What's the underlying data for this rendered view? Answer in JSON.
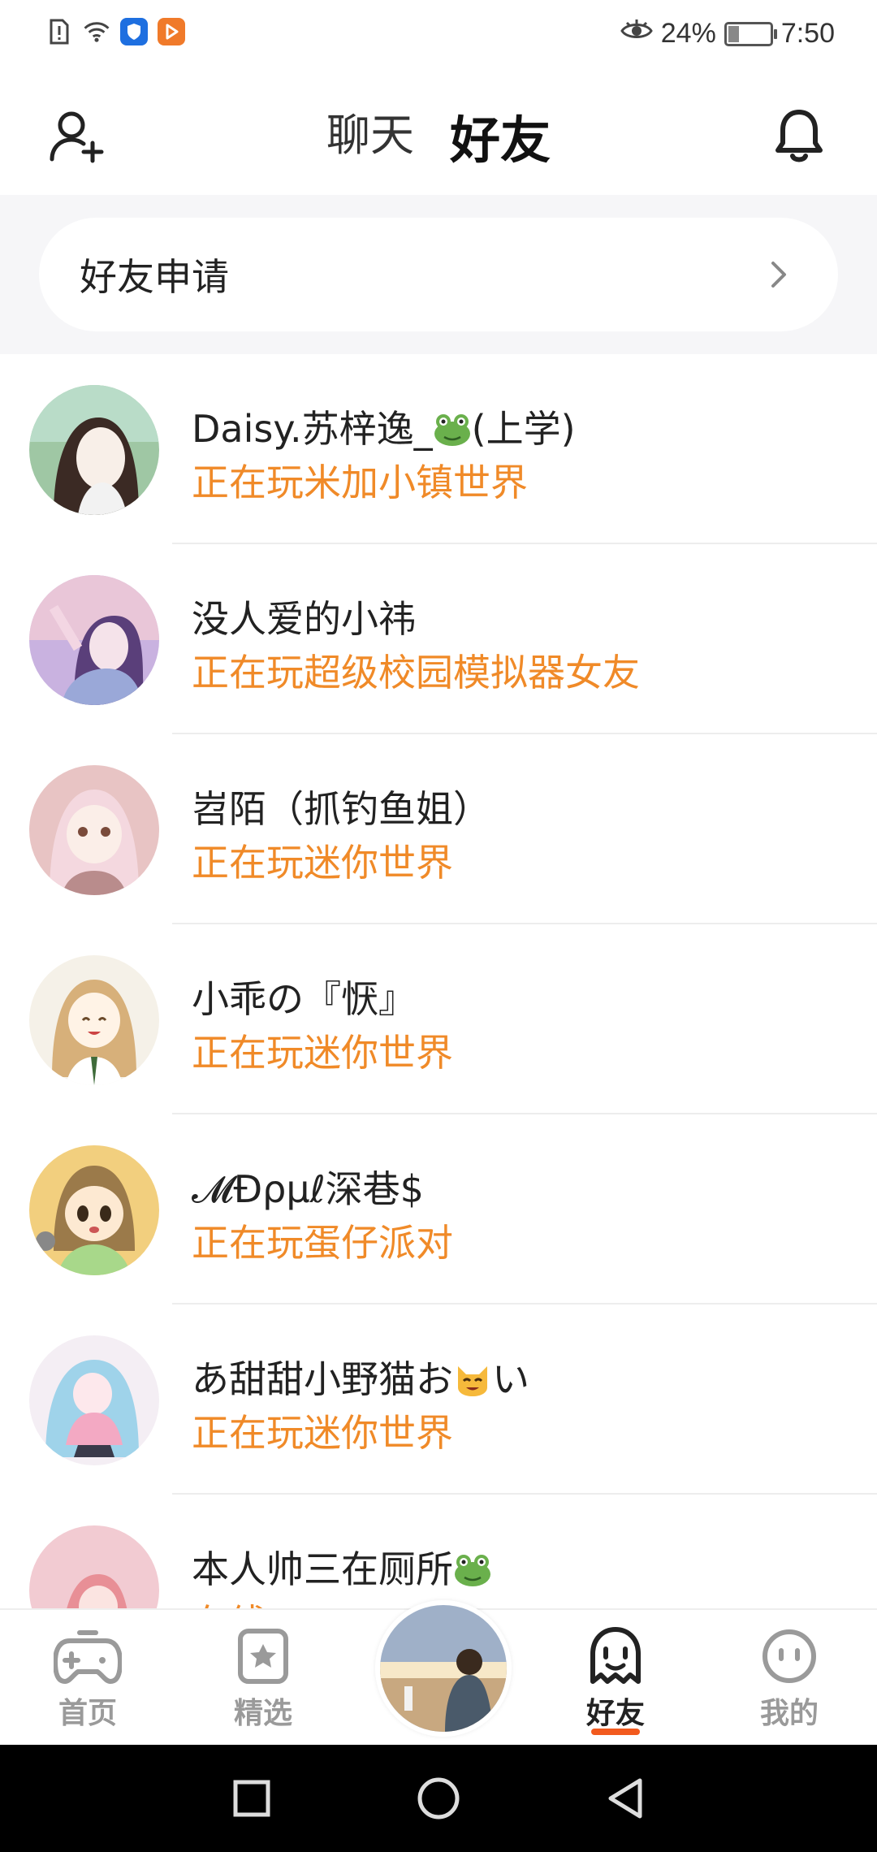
{
  "status_bar": {
    "battery": "24%",
    "time": "7:50",
    "battery_level": 0.24
  },
  "header": {
    "tabs": [
      {
        "label": "聊天"
      },
      {
        "label": "好友"
      }
    ],
    "active_tab": "好友"
  },
  "friend_request": {
    "label": "好友申请"
  },
  "friends": [
    {
      "name": "Daisy.苏梓逸_",
      "name_suffix": "(上学)",
      "status": "正在玩米加小镇世界"
    },
    {
      "name": "没人爱的小祎",
      "status": "正在玩超级校园模拟器女友"
    },
    {
      "name": "岧陌（抓钓鱼姐）",
      "status": "正在玩迷你世界"
    },
    {
      "name": "小乖の『恹』",
      "status": "正在玩迷你世界"
    },
    {
      "name": "𝓜Ɖρμℓ深巷$",
      "status": "正在玩蛋仔派对"
    },
    {
      "name": "あ甜甜小野猫お",
      "name_suffix": "い",
      "status": "正在玩迷你世界"
    },
    {
      "name": "本人帅三在厕所",
      "status": "在线"
    }
  ],
  "bottom_nav": [
    {
      "label": "首页",
      "icon": "gamepad-icon"
    },
    {
      "label": "精选",
      "icon": "star-card-icon"
    },
    {
      "label": "好友",
      "icon": "ghost-icon"
    },
    {
      "label": "我的",
      "icon": "smiley-icon"
    }
  ],
  "colors": {
    "accent": "#f25a1e",
    "status_text": "#f08a28",
    "nav_inactive": "#9a9a9a"
  }
}
